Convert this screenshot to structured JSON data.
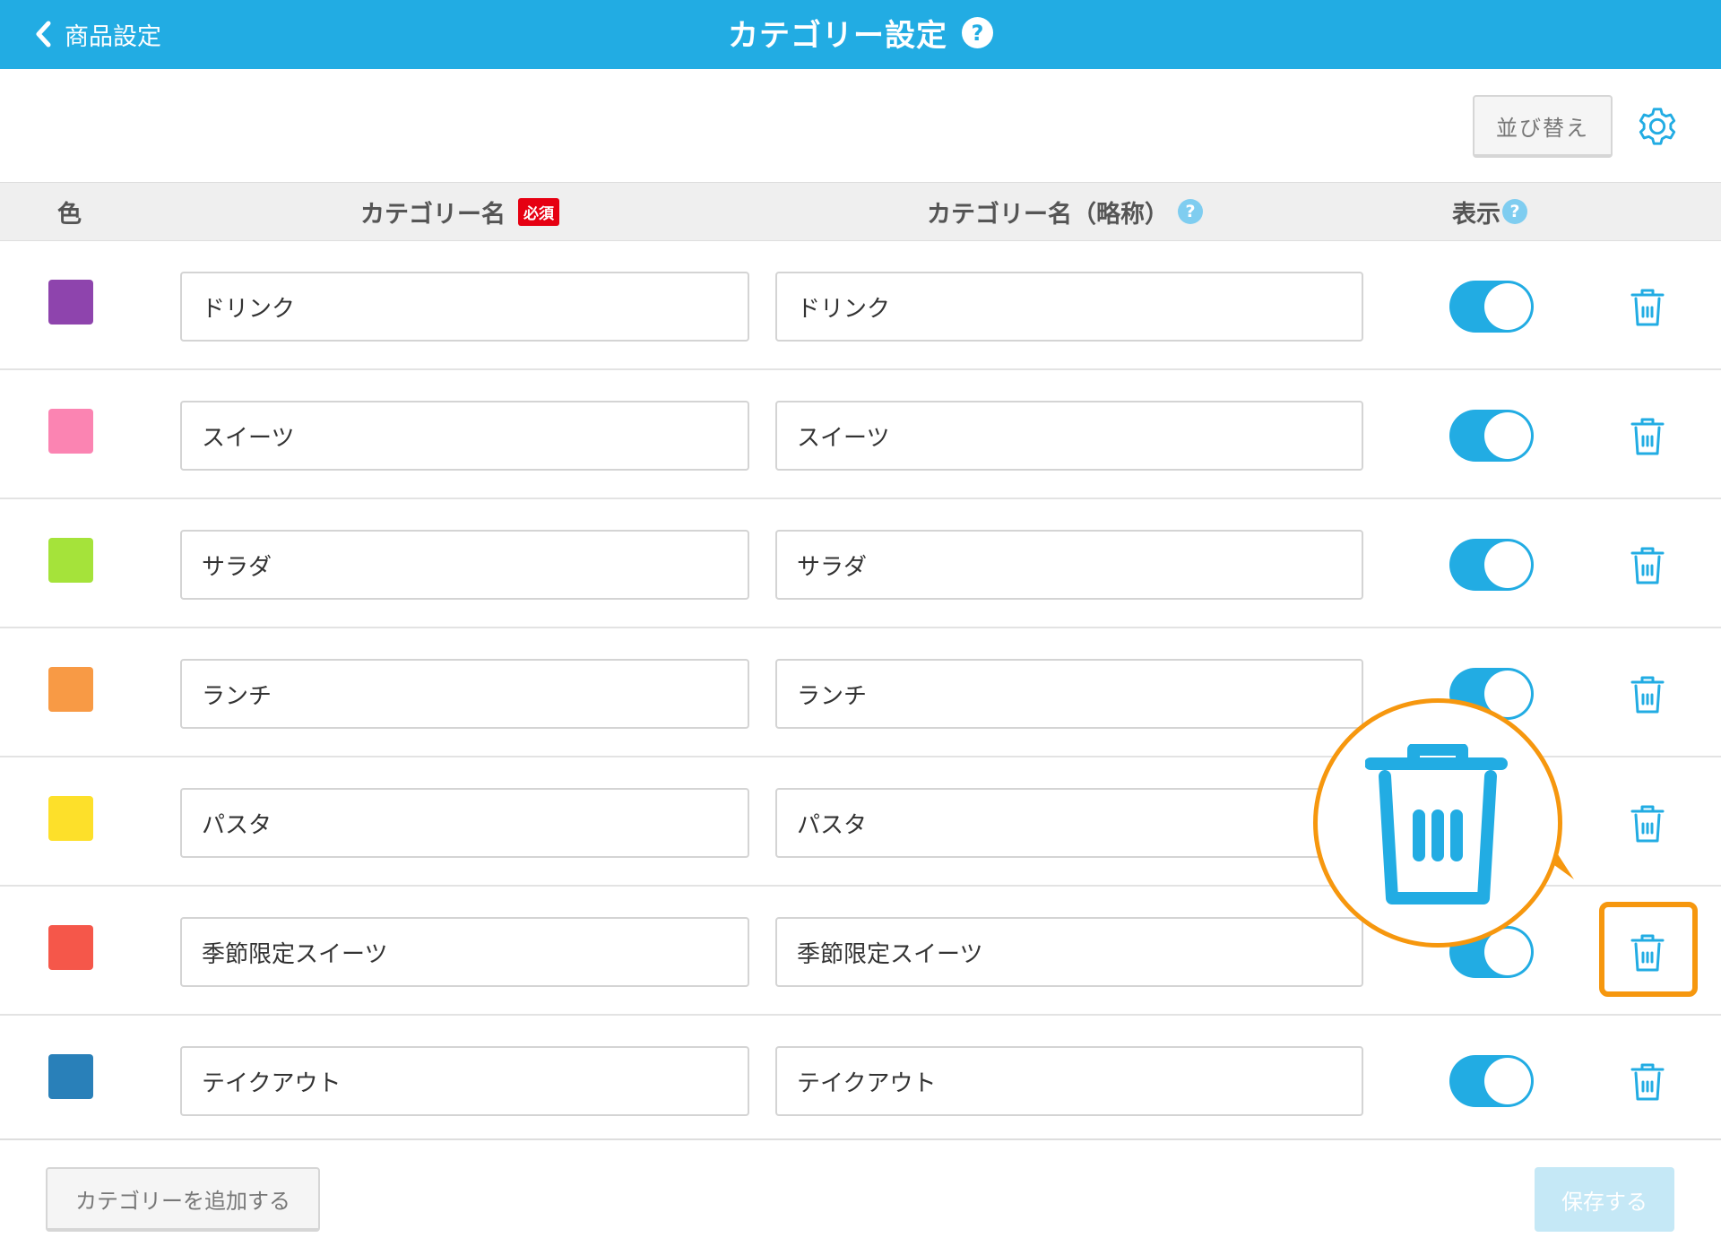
{
  "header": {
    "back_label": "商品設定",
    "title": "カテゴリー設定",
    "help": "?",
    "bg_color": "#22ace3"
  },
  "toolbar": {
    "sort_label": "並び替え",
    "settings_icon": "gear-icon"
  },
  "table": {
    "columns": {
      "color": "色",
      "name": "カテゴリー名",
      "required_badge": "必須",
      "short_name": "カテゴリー名（略称）",
      "display": "表示"
    },
    "help": "?",
    "rows": [
      {
        "color": "#8e44ad",
        "name": "ドリンク",
        "short_name": "ドリンク",
        "display": true
      },
      {
        "color": "#fb84b2",
        "name": "スイーツ",
        "short_name": "スイーツ",
        "display": true
      },
      {
        "color": "#a5e33a",
        "name": "サラダ",
        "short_name": "サラダ",
        "display": true
      },
      {
        "color": "#f89a45",
        "name": "ランチ",
        "short_name": "ランチ",
        "display": true
      },
      {
        "color": "#fde02a",
        "name": "パスタ",
        "short_name": "パスタ",
        "display": true
      },
      {
        "color": "#f5574a",
        "name": "季節限定スイーツ",
        "short_name": "季節限定スイーツ",
        "display": true
      },
      {
        "color": "#2980b9",
        "name": "テイクアウト",
        "short_name": "テイクアウト",
        "display": true
      }
    ]
  },
  "highlight": {
    "row_index": 5,
    "target": "trash-icon",
    "color": "#f6970e"
  },
  "footer": {
    "add_label": "カテゴリーを追加する",
    "save_label": "保存する"
  }
}
